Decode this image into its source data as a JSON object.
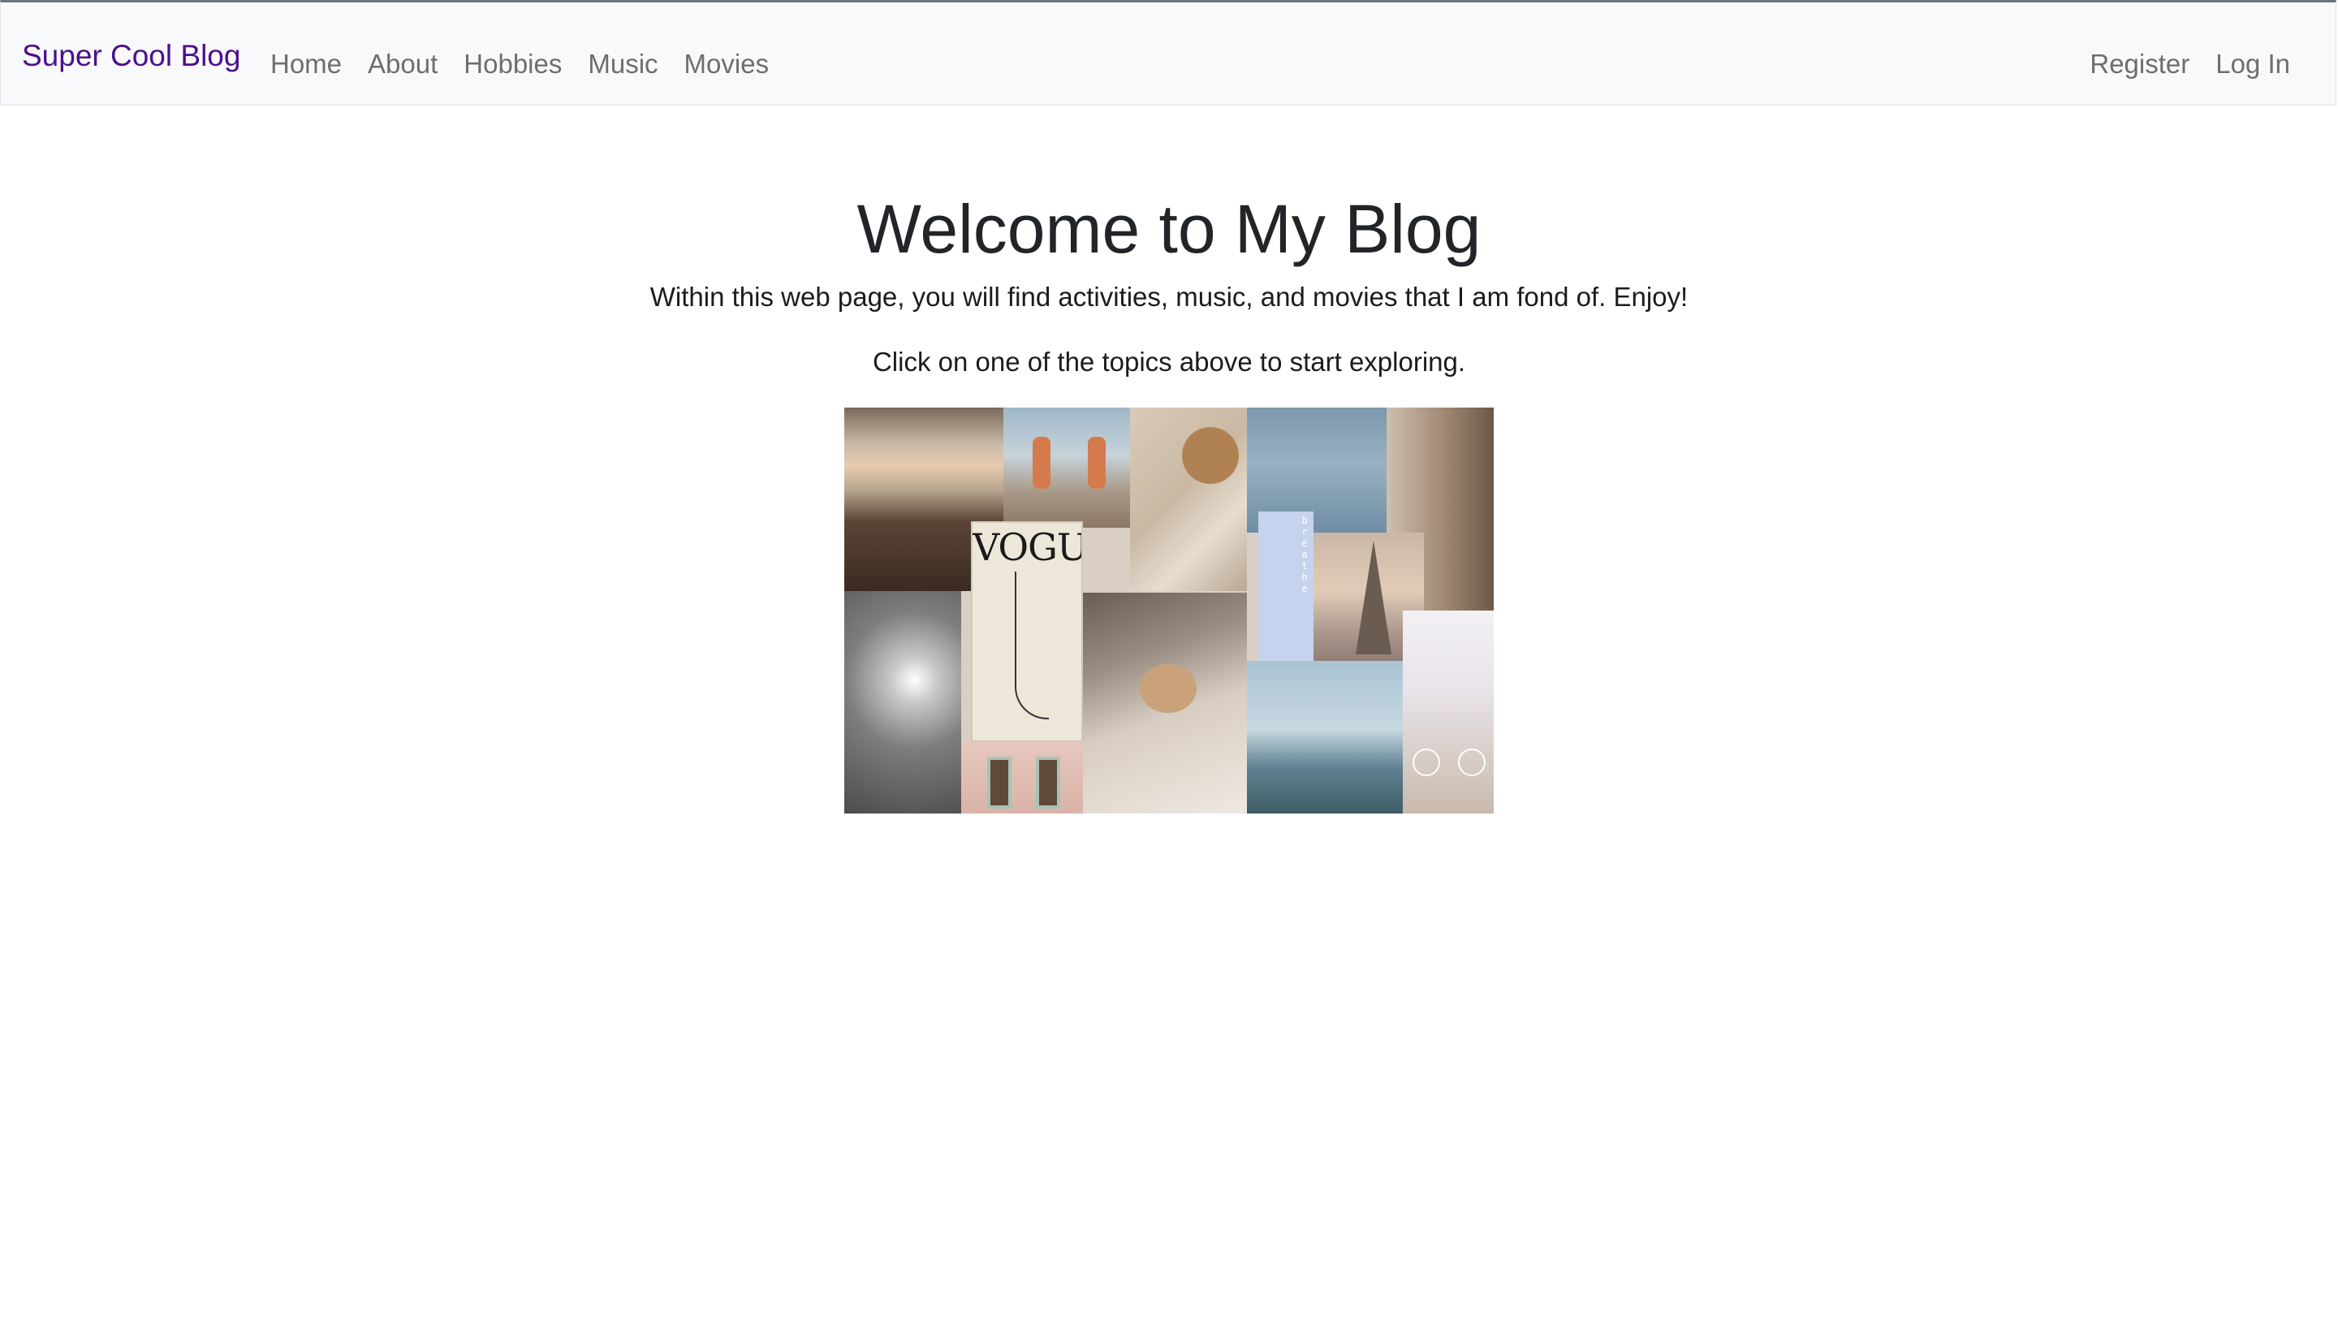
{
  "navbar": {
    "brand": "Super Cool Blog",
    "links": [
      "Home",
      "About",
      "Hobbies",
      "Music",
      "Movies"
    ],
    "auth_links": [
      "Register",
      "Log In"
    ]
  },
  "colors": {
    "brand": "#4b0f8c",
    "nav_link": "#6e6e6e",
    "navbar_bg": "#f8f9fa"
  },
  "hero": {
    "title": "Welcome to My Blog",
    "subtitle": "Within this web page, you will find activities, music, and movies that I am fond of. Enjoy!",
    "hint": "Click on one of the topics above to start exploring."
  },
  "collage": {
    "vogue_text": "VOGUE",
    "breathe_text": "breathe"
  }
}
